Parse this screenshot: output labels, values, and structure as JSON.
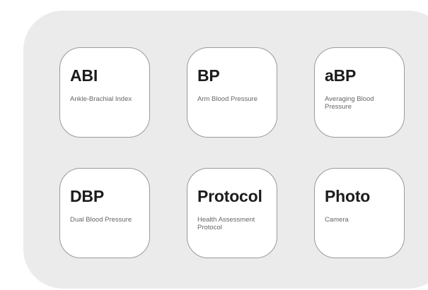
{
  "tiles": [
    {
      "title": "ABI",
      "subtitle": "Ankle-Brachial Index"
    },
    {
      "title": "BP",
      "subtitle": "Arm Blood Pressure"
    },
    {
      "title": "aBP",
      "subtitle": "Averaging Blood Pressure"
    },
    {
      "title": "DBP",
      "subtitle": "Dual Blood Pressure"
    },
    {
      "title": "Protocol",
      "subtitle": "Health Assessment Protocol"
    },
    {
      "title": "Photo",
      "subtitle": "Camera"
    }
  ]
}
